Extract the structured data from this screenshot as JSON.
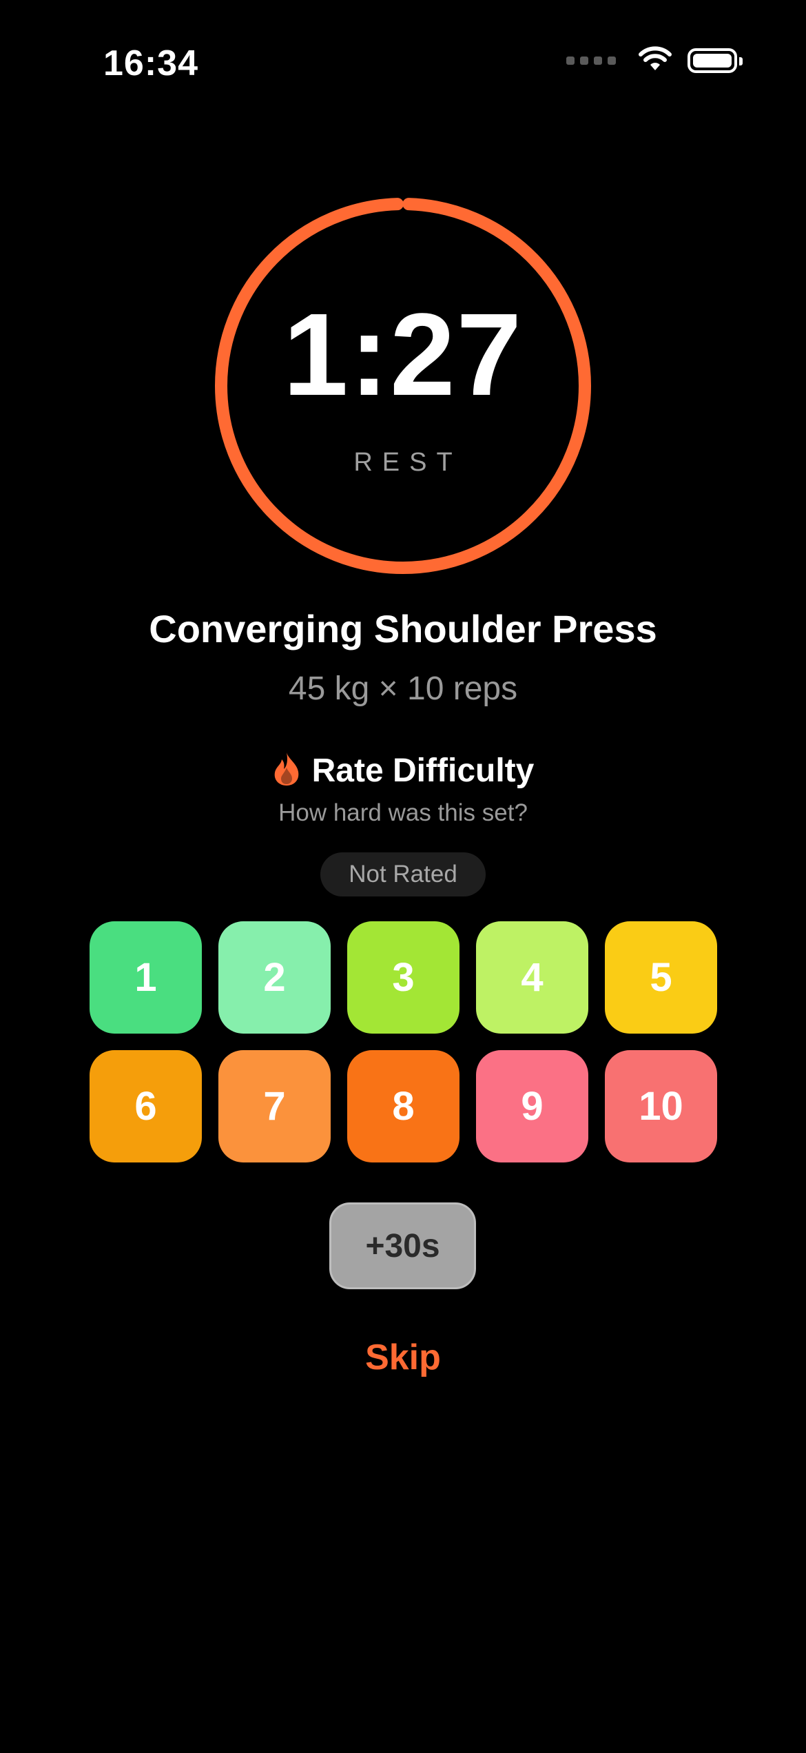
{
  "status_bar": {
    "time": "16:34"
  },
  "timer": {
    "value": "1:27",
    "label": "REST",
    "progress_fraction": 0.99,
    "ring_color": "#FF6A33"
  },
  "exercise": {
    "name": "Converging Shoulder Press",
    "detail": "45 kg × 10 reps"
  },
  "rating": {
    "icon": "flame-icon",
    "title": "Rate Difficulty",
    "subtitle": "How hard was this set?",
    "current": "Not Rated",
    "options": [
      {
        "label": "1",
        "color": "#4ADE80"
      },
      {
        "label": "2",
        "color": "#86EFAC"
      },
      {
        "label": "3",
        "color": "#A3E635"
      },
      {
        "label": "4",
        "color": "#BEF264"
      },
      {
        "label": "5",
        "color": "#FACC15"
      },
      {
        "label": "6",
        "color": "#F59E0B"
      },
      {
        "label": "7",
        "color": "#FB923C"
      },
      {
        "label": "8",
        "color": "#F97316"
      },
      {
        "label": "9",
        "color": "#FB7185"
      },
      {
        "label": "10",
        "color": "#F87171"
      }
    ]
  },
  "actions": {
    "add_time_label": "+30s",
    "skip_label": "Skip",
    "accent_color": "#FF6A33"
  }
}
